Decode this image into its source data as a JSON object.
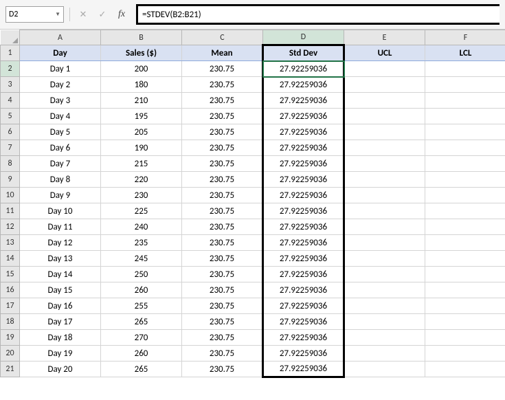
{
  "nameBox": "D2",
  "formula": "=STDEV(B2:B21)",
  "colHeaders": [
    "A",
    "B",
    "C",
    "D",
    "E",
    "F"
  ],
  "activeCol": "D",
  "activeRow": 2,
  "dataHeaders": {
    "A": "Day",
    "B": "Sales ($)",
    "C": "Mean",
    "D": "Std Dev",
    "E": "UCL",
    "F": "LCL"
  },
  "rows": [
    {
      "n": 1
    },
    {
      "n": 2,
      "day": "Day 1",
      "sales": "200",
      "mean": "230.75",
      "sd": "27.92259036"
    },
    {
      "n": 3,
      "day": "Day 2",
      "sales": "180",
      "mean": "230.75",
      "sd": "27.92259036"
    },
    {
      "n": 4,
      "day": "Day 3",
      "sales": "210",
      "mean": "230.75",
      "sd": "27.92259036"
    },
    {
      "n": 5,
      "day": "Day 4",
      "sales": "195",
      "mean": "230.75",
      "sd": "27.92259036"
    },
    {
      "n": 6,
      "day": "Day 5",
      "sales": "205",
      "mean": "230.75",
      "sd": "27.92259036"
    },
    {
      "n": 7,
      "day": "Day 6",
      "sales": "190",
      "mean": "230.75",
      "sd": "27.92259036"
    },
    {
      "n": 8,
      "day": "Day 7",
      "sales": "215",
      "mean": "230.75",
      "sd": "27.92259036"
    },
    {
      "n": 9,
      "day": "Day 8",
      "sales": "220",
      "mean": "230.75",
      "sd": "27.92259036"
    },
    {
      "n": 10,
      "day": "Day 9",
      "sales": "230",
      "mean": "230.75",
      "sd": "27.92259036"
    },
    {
      "n": 11,
      "day": "Day 10",
      "sales": "225",
      "mean": "230.75",
      "sd": "27.92259036"
    },
    {
      "n": 12,
      "day": "Day 11",
      "sales": "240",
      "mean": "230.75",
      "sd": "27.92259036"
    },
    {
      "n": 13,
      "day": "Day 12",
      "sales": "235",
      "mean": "230.75",
      "sd": "27.92259036"
    },
    {
      "n": 14,
      "day": "Day 13",
      "sales": "245",
      "mean": "230.75",
      "sd": "27.92259036"
    },
    {
      "n": 15,
      "day": "Day 14",
      "sales": "250",
      "mean": "230.75",
      "sd": "27.92259036"
    },
    {
      "n": 16,
      "day": "Day 15",
      "sales": "260",
      "mean": "230.75",
      "sd": "27.92259036"
    },
    {
      "n": 17,
      "day": "Day 16",
      "sales": "255",
      "mean": "230.75",
      "sd": "27.92259036"
    },
    {
      "n": 18,
      "day": "Day 17",
      "sales": "265",
      "mean": "230.75",
      "sd": "27.92259036"
    },
    {
      "n": 19,
      "day": "Day 18",
      "sales": "270",
      "mean": "230.75",
      "sd": "27.92259036"
    },
    {
      "n": 20,
      "day": "Day 19",
      "sales": "260",
      "mean": "230.75",
      "sd": "27.92259036"
    },
    {
      "n": 21,
      "day": "Day 20",
      "sales": "265",
      "mean": "230.75",
      "sd": "27.92259036"
    }
  ]
}
